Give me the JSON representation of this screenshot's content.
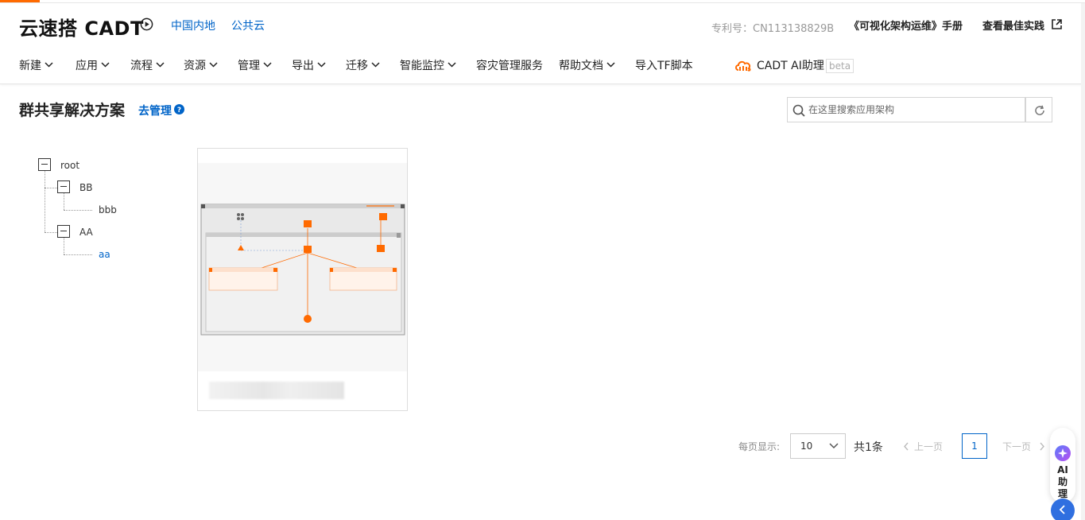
{
  "header": {
    "brand": "云速搭 CADT",
    "regions": [
      "中国内地",
      "公共云"
    ],
    "patent": "专利号：CN113138829B",
    "manual": "《可视化架构运维》手册",
    "best_practice": "查看最佳实践"
  },
  "nav": {
    "items": [
      {
        "label": "新建",
        "dropdown": true
      },
      {
        "label": "应用",
        "dropdown": true
      },
      {
        "label": "流程",
        "dropdown": true
      },
      {
        "label": "资源",
        "dropdown": true
      },
      {
        "label": "管理",
        "dropdown": true
      },
      {
        "label": "导出",
        "dropdown": true
      },
      {
        "label": "迁移",
        "dropdown": true
      },
      {
        "label": "智能监控",
        "dropdown": true
      },
      {
        "label": "容灾管理服务",
        "dropdown": false
      },
      {
        "label": "帮助文档",
        "dropdown": true
      },
      {
        "label": "导入TF脚本",
        "dropdown": false
      }
    ],
    "ai_assistant": "CADT AI助理",
    "beta": "beta"
  },
  "section": {
    "title": "群共享解决方案",
    "manage_link": "去管理"
  },
  "search": {
    "placeholder": "在这里搜索应用架构"
  },
  "tree": {
    "root": "root",
    "nodes": [
      {
        "label": "BB",
        "children": [
          "bbb"
        ]
      },
      {
        "label": "AA",
        "children": [
          "aa"
        ]
      }
    ],
    "active": "aa"
  },
  "pagination": {
    "per_page_label": "每页显示:",
    "page_size": "10",
    "total": "共1条",
    "prev": "上一页",
    "next": "下一页",
    "current_page": "1"
  },
  "ai_float": {
    "label_line1": "AI",
    "label_line2": "助",
    "label_line3": "理"
  },
  "colors": {
    "accent": "#ff6a00",
    "link": "#0064c8",
    "float_button": "#2f6fe0"
  }
}
